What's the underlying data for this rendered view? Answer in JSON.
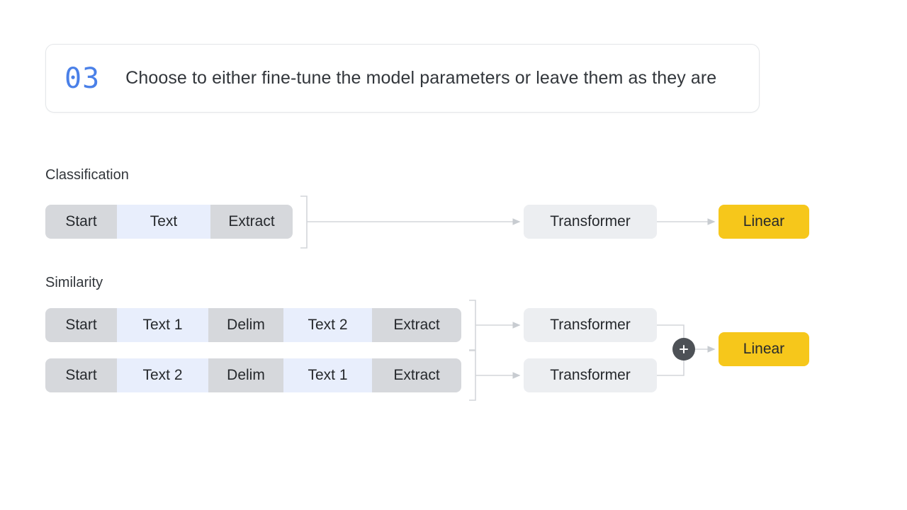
{
  "header": {
    "step_number": "03",
    "text": "Choose to either fine-tune the model parameters or leave them as they are",
    "accent_color": "#4a80e8"
  },
  "colors": {
    "token_gray": "#d6d8dc",
    "token_blue": "#e8eefc",
    "transformer_bg": "#eceef1",
    "linear_bg": "#f6c71b",
    "wire": "#d3d6da",
    "merge_node": "#4d5156",
    "text": "#26292d",
    "page_bg": "#ffffff"
  },
  "sections": [
    {
      "label": "Classification",
      "rows": [
        {
          "tokens": [
            {
              "label": "Start",
              "style": "gray"
            },
            {
              "label": "Text",
              "style": "blue"
            },
            {
              "label": "Extract",
              "style": "gray"
            }
          ]
        }
      ],
      "transformers": [
        {
          "label": "Transformer"
        }
      ],
      "output": {
        "label": "Linear"
      },
      "merge": false
    },
    {
      "label": "Similarity",
      "rows": [
        {
          "tokens": [
            {
              "label": "Start",
              "style": "gray"
            },
            {
              "label": "Text 1",
              "style": "blue"
            },
            {
              "label": "Delim",
              "style": "gray"
            },
            {
              "label": "Text 2",
              "style": "blue"
            },
            {
              "label": "Extract",
              "style": "gray"
            }
          ]
        },
        {
          "tokens": [
            {
              "label": "Start",
              "style": "gray"
            },
            {
              "label": "Text 2",
              "style": "blue"
            },
            {
              "label": "Delim",
              "style": "gray"
            },
            {
              "label": "Text 1",
              "style": "blue"
            },
            {
              "label": "Extract",
              "style": "gray"
            }
          ]
        }
      ],
      "transformers": [
        {
          "label": "Transformer"
        },
        {
          "label": "Transformer"
        }
      ],
      "output": {
        "label": "Linear"
      },
      "merge": true,
      "merge_icon": "plus-icon"
    }
  ]
}
